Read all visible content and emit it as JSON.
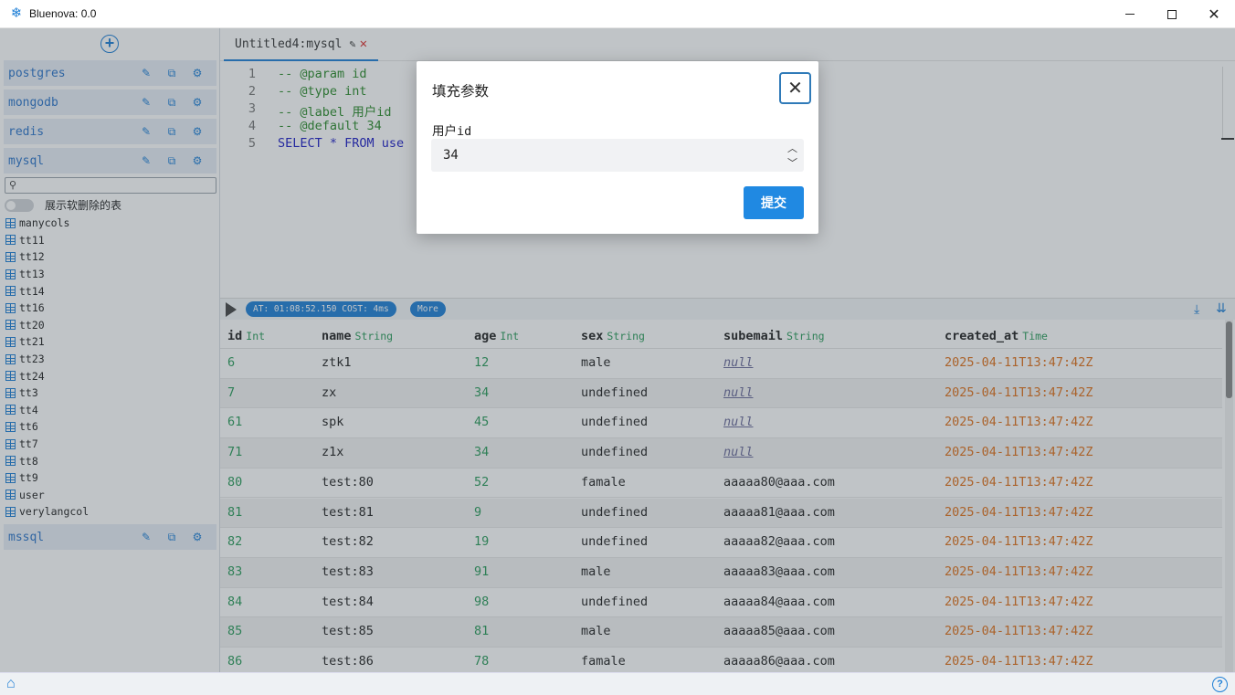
{
  "window": {
    "title": "Bluenova: 0.0",
    "minimize_glyph": "",
    "close_glyph": "✕"
  },
  "sidebar": {
    "connections_top": [
      {
        "name": "postgres"
      },
      {
        "name": "mongodb"
      },
      {
        "name": "redis"
      },
      {
        "name": "mysql"
      }
    ],
    "connections_bottom": [
      {
        "name": "mssql"
      }
    ],
    "search_placeholder": "",
    "toggle_label": "展示软删除的表",
    "tables": [
      "manycols",
      "tt11",
      "tt12",
      "tt13",
      "tt14",
      "tt16",
      "tt20",
      "tt21",
      "tt23",
      "tt24",
      "tt3",
      "tt4",
      "tt6",
      "tt7",
      "tt8",
      "tt9",
      "user",
      "verylangcol"
    ]
  },
  "editor": {
    "tab_label": "Untitled4:mysql",
    "lines": [
      {
        "n": "1",
        "text": "-- @param id",
        "kind": "comment"
      },
      {
        "n": "2",
        "text": "-- @type int",
        "kind": "comment"
      },
      {
        "n": "3",
        "text": "-- @label 用户id",
        "kind": "comment"
      },
      {
        "n": "4",
        "text": "-- @default 34",
        "kind": "comment"
      },
      {
        "n": "5",
        "text": "SELECT * FROM use",
        "kind": "sql"
      }
    ]
  },
  "results": {
    "status": "AT: 01:08:52.150 COST: 4ms",
    "more_label": "More",
    "columns": [
      {
        "name": "id",
        "type": "Int"
      },
      {
        "name": "name",
        "type": "String"
      },
      {
        "name": "age",
        "type": "Int"
      },
      {
        "name": "sex",
        "type": "String"
      },
      {
        "name": "subemail",
        "type": "String"
      },
      {
        "name": "created_at",
        "type": "Time"
      }
    ],
    "rows": [
      [
        "6",
        "ztk1",
        "12",
        "male",
        "null",
        "2025-04-11T13:47:42Z"
      ],
      [
        "7",
        "zx",
        "34",
        "undefined",
        "null",
        "2025-04-11T13:47:42Z"
      ],
      [
        "61",
        "spk",
        "45",
        "undefined",
        "null",
        "2025-04-11T13:47:42Z"
      ],
      [
        "71",
        "z1x",
        "34",
        "undefined",
        "null",
        "2025-04-11T13:47:42Z"
      ],
      [
        "80",
        "test:80",
        "52",
        "famale",
        "aaaaa80@aaa.com",
        "2025-04-11T13:47:42Z"
      ],
      [
        "81",
        "test:81",
        "9",
        "undefined",
        "aaaaa81@aaa.com",
        "2025-04-11T13:47:42Z"
      ],
      [
        "82",
        "test:82",
        "19",
        "undefined",
        "aaaaa82@aaa.com",
        "2025-04-11T13:47:42Z"
      ],
      [
        "83",
        "test:83",
        "91",
        "male",
        "aaaaa83@aaa.com",
        "2025-04-11T13:47:42Z"
      ],
      [
        "84",
        "test:84",
        "98",
        "undefined",
        "aaaaa84@aaa.com",
        "2025-04-11T13:47:42Z"
      ],
      [
        "85",
        "test:85",
        "81",
        "male",
        "aaaaa85@aaa.com",
        "2025-04-11T13:47:42Z"
      ],
      [
        "86",
        "test:86",
        "78",
        "famale",
        "aaaaa86@aaa.com",
        "2025-04-11T13:47:42Z"
      ]
    ]
  },
  "modal": {
    "title": "填充参数",
    "field_label_cn": "用户",
    "field_label_id": "id",
    "field_value": "34",
    "submit_label": "提交"
  },
  "colors": {
    "accent": "#1e7fd6",
    "int_type": "#2a9b5a",
    "time_value": "#e0701a"
  }
}
